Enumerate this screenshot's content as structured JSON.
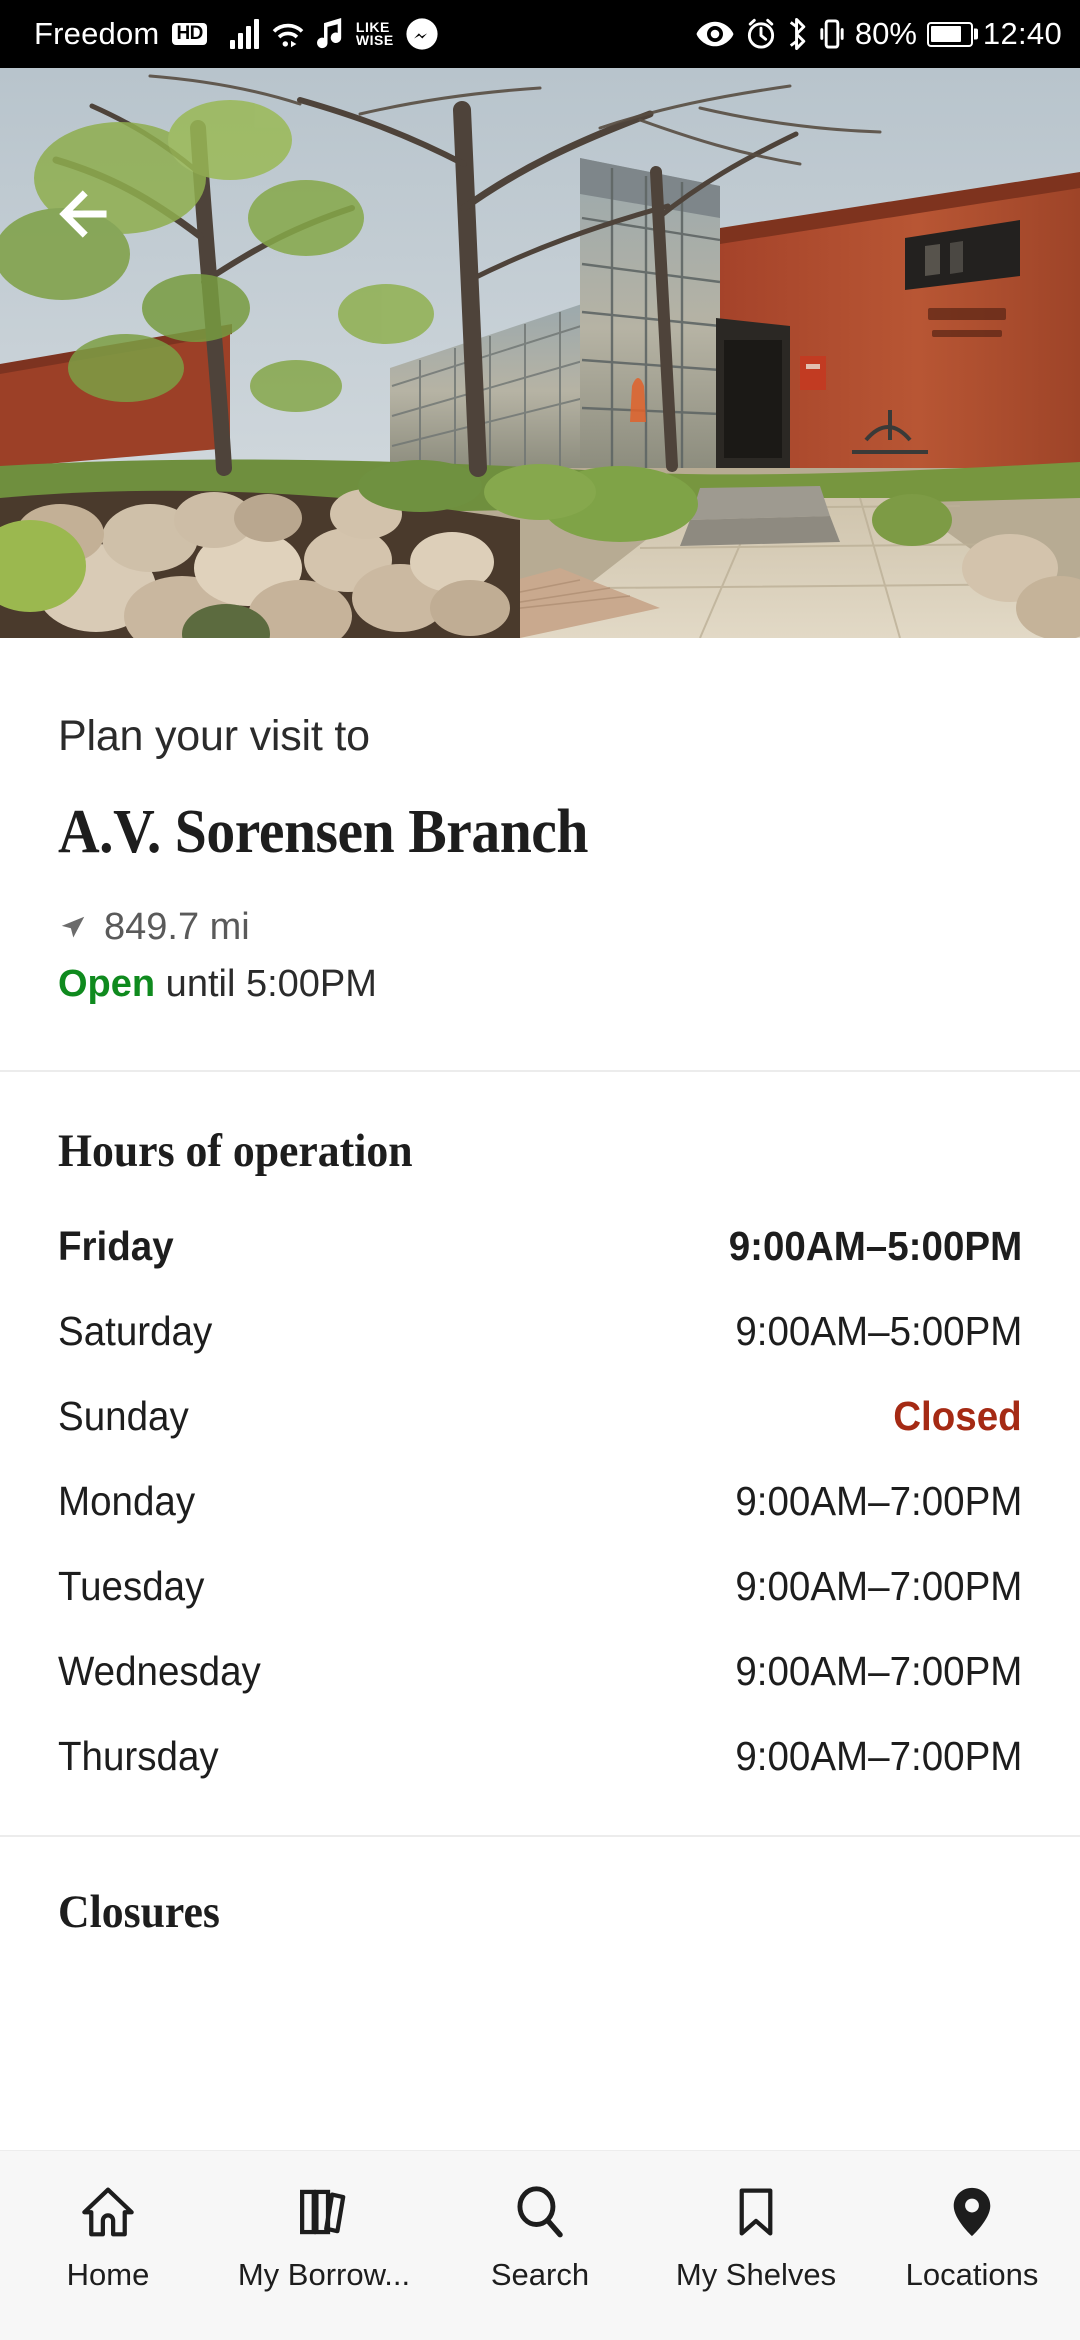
{
  "status_bar": {
    "carrier": "Freedom",
    "hd_badge": "HD",
    "likewise_line1": "LIKE",
    "likewise_line2": "WISE",
    "battery_percent": "80%",
    "battery_level": 80,
    "time": "12:40",
    "icons": [
      "signal-bars-icon",
      "wifi-icon",
      "music-note-icon",
      "likewise-icon",
      "messenger-icon",
      "eye-icon",
      "alarm-clock-icon",
      "bluetooth-icon",
      "vibrate-icon",
      "battery-icon"
    ]
  },
  "hero": {
    "back_icon": "back-arrow-icon",
    "alt": "A.V. Sorensen Branch library exterior with red brick walls, glass atrium entrance, trees and a rock garden"
  },
  "detail": {
    "eyebrow": "Plan your visit to",
    "branch_name": "A.V. Sorensen Branch",
    "distance": "849.7 mi",
    "distance_icon": "navigation-arrow-icon",
    "open_word": "Open",
    "open_suffix": " until 5:00PM",
    "open_color": "#0f8a1e"
  },
  "hours": {
    "heading": "Hours of operation",
    "closed_color": "#a52a14",
    "rows": [
      {
        "day": "Friday",
        "value": "9:00AM–5:00PM",
        "today": true,
        "closed": false
      },
      {
        "day": "Saturday",
        "value": "9:00AM–5:00PM",
        "today": false,
        "closed": false
      },
      {
        "day": "Sunday",
        "value": "Closed",
        "today": false,
        "closed": true
      },
      {
        "day": "Monday",
        "value": "9:00AM–7:00PM",
        "today": false,
        "closed": false
      },
      {
        "day": "Tuesday",
        "value": "9:00AM–7:00PM",
        "today": false,
        "closed": false
      },
      {
        "day": "Wednesday",
        "value": "9:00AM–7:00PM",
        "today": false,
        "closed": false
      },
      {
        "day": "Thursday",
        "value": "9:00AM–7:00PM",
        "today": false,
        "closed": false
      }
    ]
  },
  "closures": {
    "heading": "Closures"
  },
  "bottom_nav": {
    "active": "Locations",
    "items": [
      {
        "label": "Home",
        "icon": "home-icon"
      },
      {
        "label": "My Borrow...",
        "icon": "books-icon"
      },
      {
        "label": "Search",
        "icon": "search-icon"
      },
      {
        "label": "My Shelves",
        "icon": "bookmark-icon"
      },
      {
        "label": "Locations",
        "icon": "map-pin-icon"
      }
    ]
  }
}
